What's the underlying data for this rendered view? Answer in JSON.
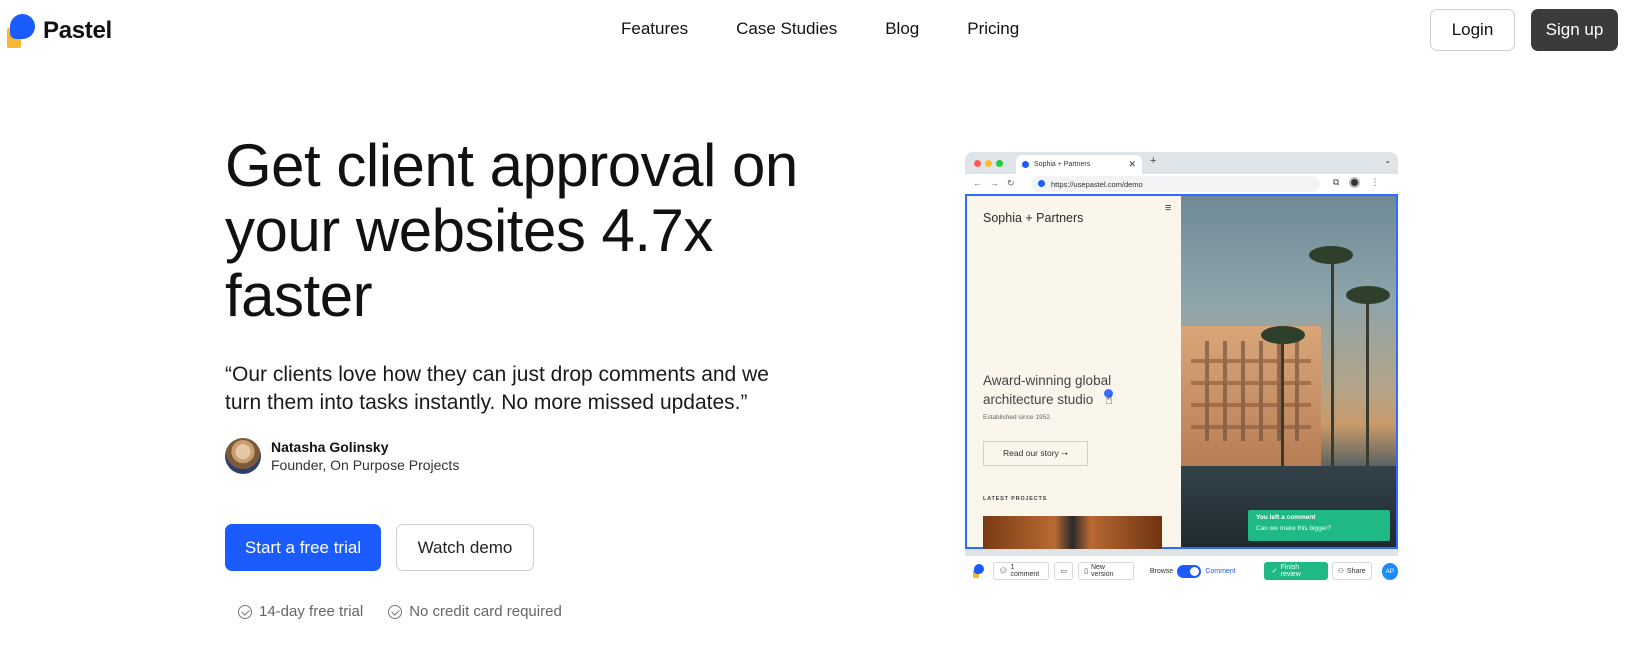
{
  "brand": {
    "name": "Pastel"
  },
  "nav": {
    "links": [
      "Features",
      "Case Studies",
      "Blog",
      "Pricing"
    ],
    "login_label": "Login",
    "signup_label": "Sign up"
  },
  "hero": {
    "title": "Get client approval on your websites 4.7x faster",
    "quote": "“Our clients love how they can just drop comments and we turn them into tasks instantly. No more missed updates.”",
    "author_name": "Natasha Golinsky",
    "author_role": "Founder, On Purpose Projects",
    "cta_primary": "Start a free trial",
    "cta_secondary": "Watch demo",
    "perks": [
      "14-day free trial",
      "No credit card required"
    ]
  },
  "mockup": {
    "tab_title": "Sophia + Partners",
    "url": "https://usepastel.com/demo",
    "site_brand": "Sophia + Partners",
    "site_headline": "Award-winning global architecture studio",
    "site_sub": "Established since 1952.",
    "site_cta": "Read our story ⭢",
    "site_latest": "LATEST PROJECTS",
    "toast_title": "You left a comment",
    "toast_msg": "Can we make this bigger?"
  },
  "pastel_toolbar": {
    "comments": "1 comment",
    "new_version": "New version",
    "browse": "Browse",
    "comment": "Comment",
    "finish": "Finish review",
    "share": "Share",
    "avatar": "AP"
  },
  "colors": {
    "accent": "#1a5cff",
    "success": "#1fb985",
    "dark_button": "#3b3b3b"
  },
  "icons": [
    "check-circle-icon",
    "chat-icon",
    "monitor-icon",
    "document-icon",
    "user-check-icon",
    "share-icon",
    "menu-icon",
    "cursor-icon"
  ]
}
